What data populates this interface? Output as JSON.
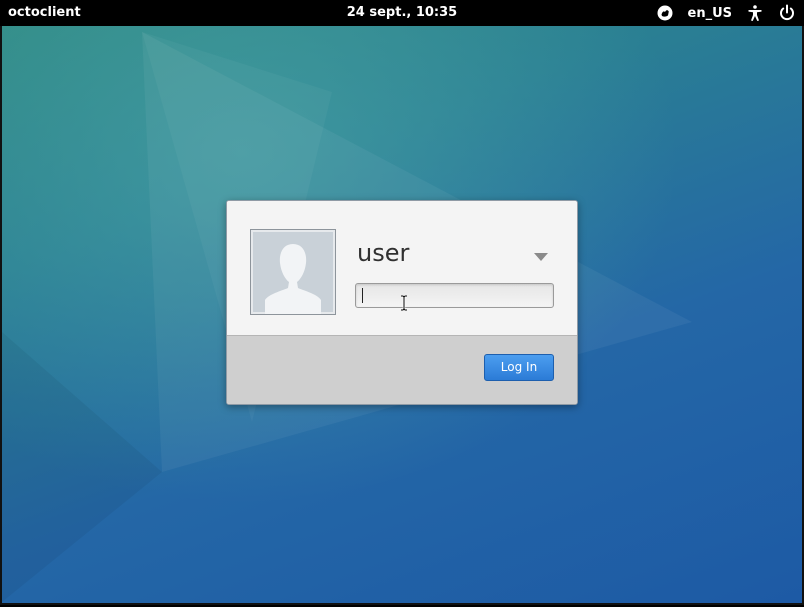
{
  "panel": {
    "app_name": "octoclient",
    "clock": "24 sept., 10:35",
    "language": "en_US",
    "indicators": [
      "session-icon",
      "accessibility-icon",
      "power-icon"
    ]
  },
  "login": {
    "username": "user",
    "password_value": "",
    "login_button": "Log In",
    "avatar_icon": "user-silhouette-icon",
    "dropdown_icon": "triangle-down-icon"
  },
  "colors": {
    "accent": "#2b7bd6",
    "panel_bg": "#000000",
    "desktop_top": "#2f8a82",
    "desktop_bottom": "#1d5aa5"
  }
}
